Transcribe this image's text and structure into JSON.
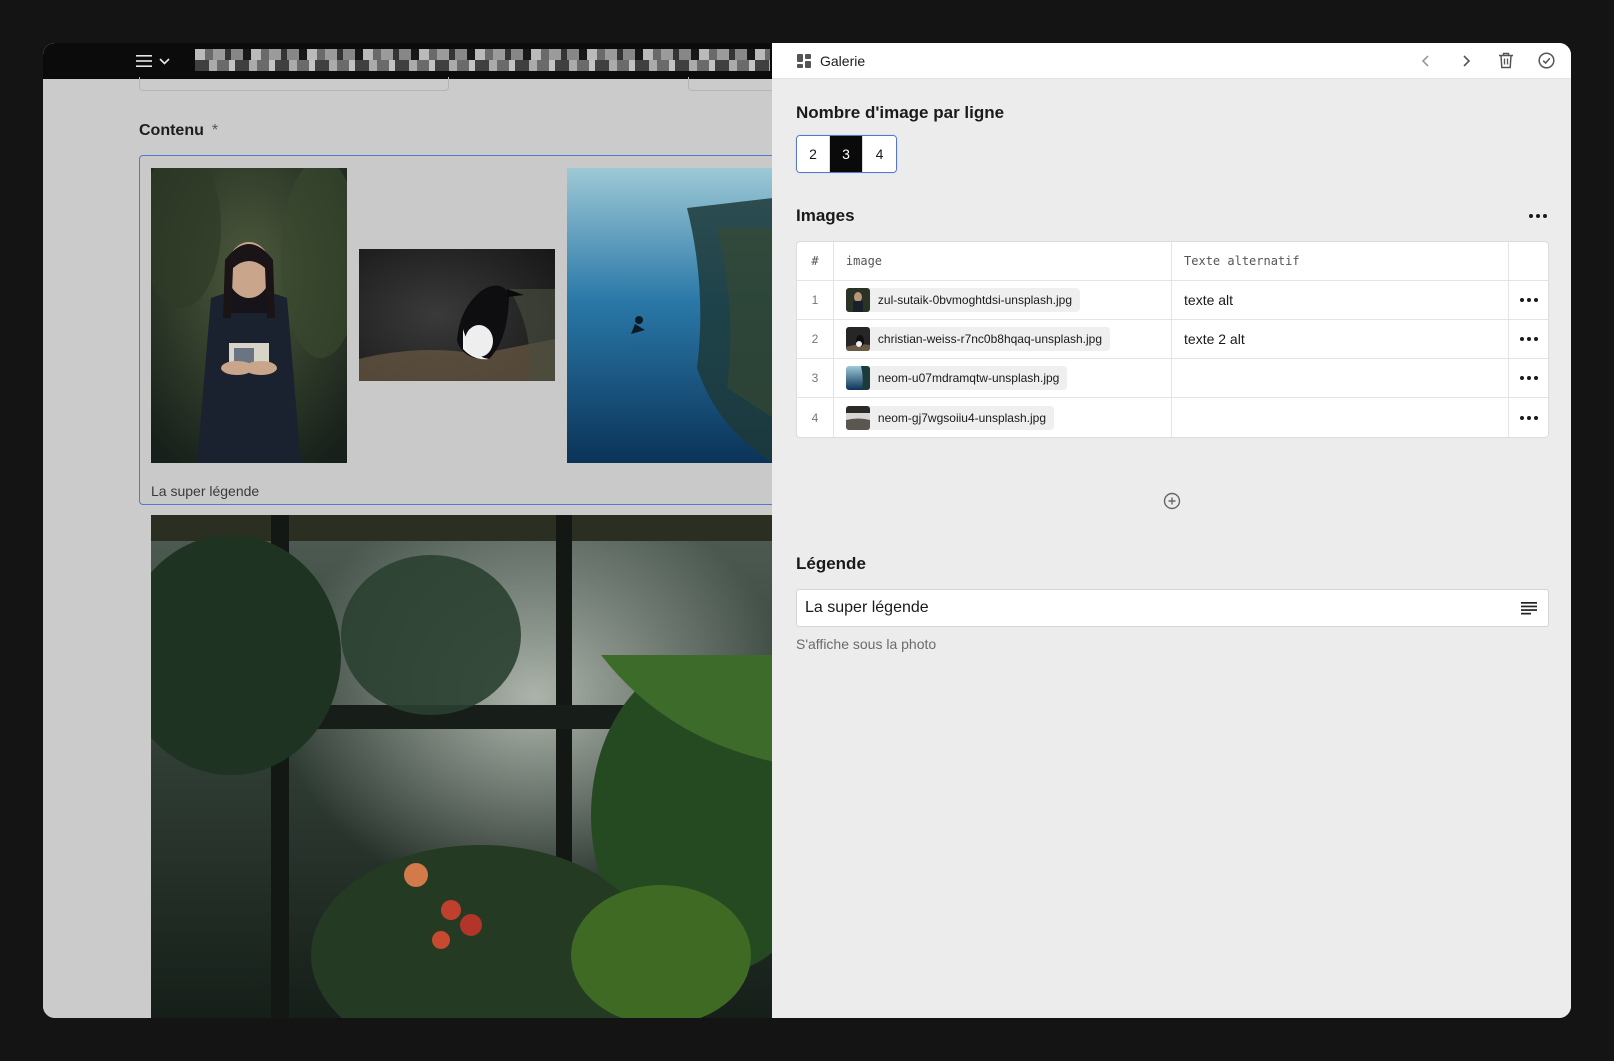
{
  "editor": {
    "content_label": "Contenu",
    "required_mark": "*",
    "caption_preview": "La super légende"
  },
  "panel": {
    "title": "Galerie",
    "icons": [
      "grid-icon",
      "chevron-left-icon",
      "chevron-right-icon",
      "trash-icon",
      "check-circle-icon"
    ],
    "per_row": {
      "label": "Nombre d'image par ligne",
      "options": [
        "2",
        "3",
        "4"
      ],
      "selected": "3"
    },
    "images": {
      "label": "Images",
      "columns": {
        "num": "#",
        "image": "image",
        "alt": "Texte alternatif"
      },
      "rows": [
        {
          "num": "1",
          "file": "zul-sutaik-0bvmoghtdsi-unsplash.jpg",
          "alt": "texte alt"
        },
        {
          "num": "2",
          "file": "christian-weiss-r7nc0b8hqaq-unsplash.jpg",
          "alt": "texte 2 alt"
        },
        {
          "num": "3",
          "file": "neom-u07mdramqtw-unsplash.jpg",
          "alt": ""
        },
        {
          "num": "4",
          "file": "neom-gj7wgsoiiu4-unsplash.jpg",
          "alt": ""
        }
      ]
    },
    "legend": {
      "label": "Légende",
      "value": "La super légende",
      "hint": "S'affiche sous la photo"
    }
  },
  "colors": {
    "accent": "#5578c8",
    "selected_segment": "#0a0a0a",
    "panel_bg": "#ececec",
    "backdrop": "#141414"
  }
}
